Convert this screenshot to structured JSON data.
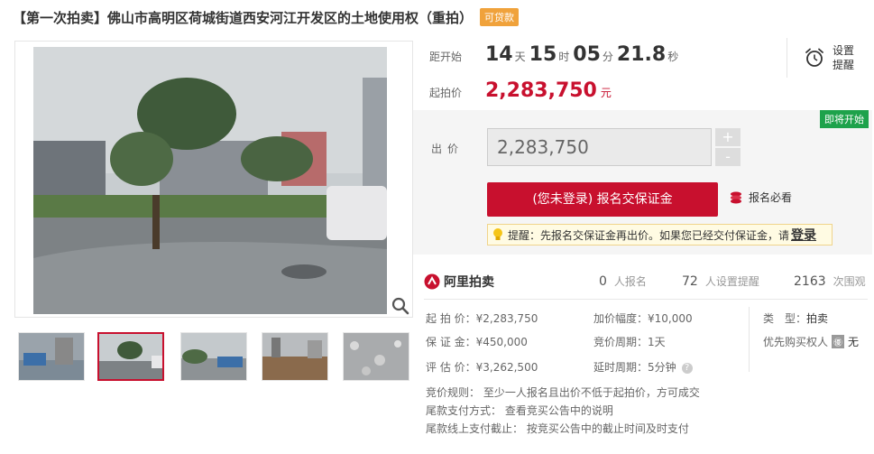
{
  "title": "【第一次拍卖】佛山市高明区荷城街道西安河江开发区的土地使用权（重拍）",
  "loan_tag": "可贷款",
  "countdown": {
    "label": "距开始",
    "days": "14",
    "days_unit": "天",
    "hours": "15",
    "hours_unit": "时",
    "minutes": "05",
    "minutes_unit": "分",
    "seconds": "21.8",
    "seconds_unit": "秒"
  },
  "alarm": {
    "label": "设置提醒"
  },
  "start_price": {
    "label": "起拍价",
    "value": "2,283,750",
    "unit": "元"
  },
  "bid": {
    "soon_tag": "即将开始",
    "label": "出价",
    "input_value": "2,283,750",
    "plus": "+",
    "minus": "-",
    "bond_button": "(您未登录) 报名交保证金",
    "must_read": "报名必看",
    "tip_text": "提醒：先报名交保证金再出价。如果您已经交付保证金，请",
    "tip_login": "登录"
  },
  "stats": {
    "brand": "阿里拍卖",
    "signups": "0",
    "signups_label": "人报名",
    "reminders": "72",
    "reminders_label": "人设置提醒",
    "views": "2163",
    "views_label": "次围观"
  },
  "details": {
    "start_price": "起 拍 价：¥2,283,750",
    "deposit": "保 证 金：¥450,000",
    "appraisal": "评 估 价：¥3,262,500",
    "increment": "加价幅度：¥10,000",
    "cycle": "竞价周期：1天",
    "delay": "延时周期：5分钟",
    "type_label": "类　型：",
    "type_value": "拍卖",
    "priority_label": "优先购买权人",
    "priority_badge": "㊝",
    "priority_value": "无",
    "rule": "竞价规则：  至少一人报名且出价不低于起拍价，方可成交",
    "payment": "尾款支付方式：  查看竞买公告中的说明",
    "deadline": "尾款线上支付截止：  按竞买公告中的截止时间及时支付"
  },
  "colors": {
    "accent": "#c8102e",
    "loan": "#f0a23b",
    "soon": "#1ea24b"
  }
}
